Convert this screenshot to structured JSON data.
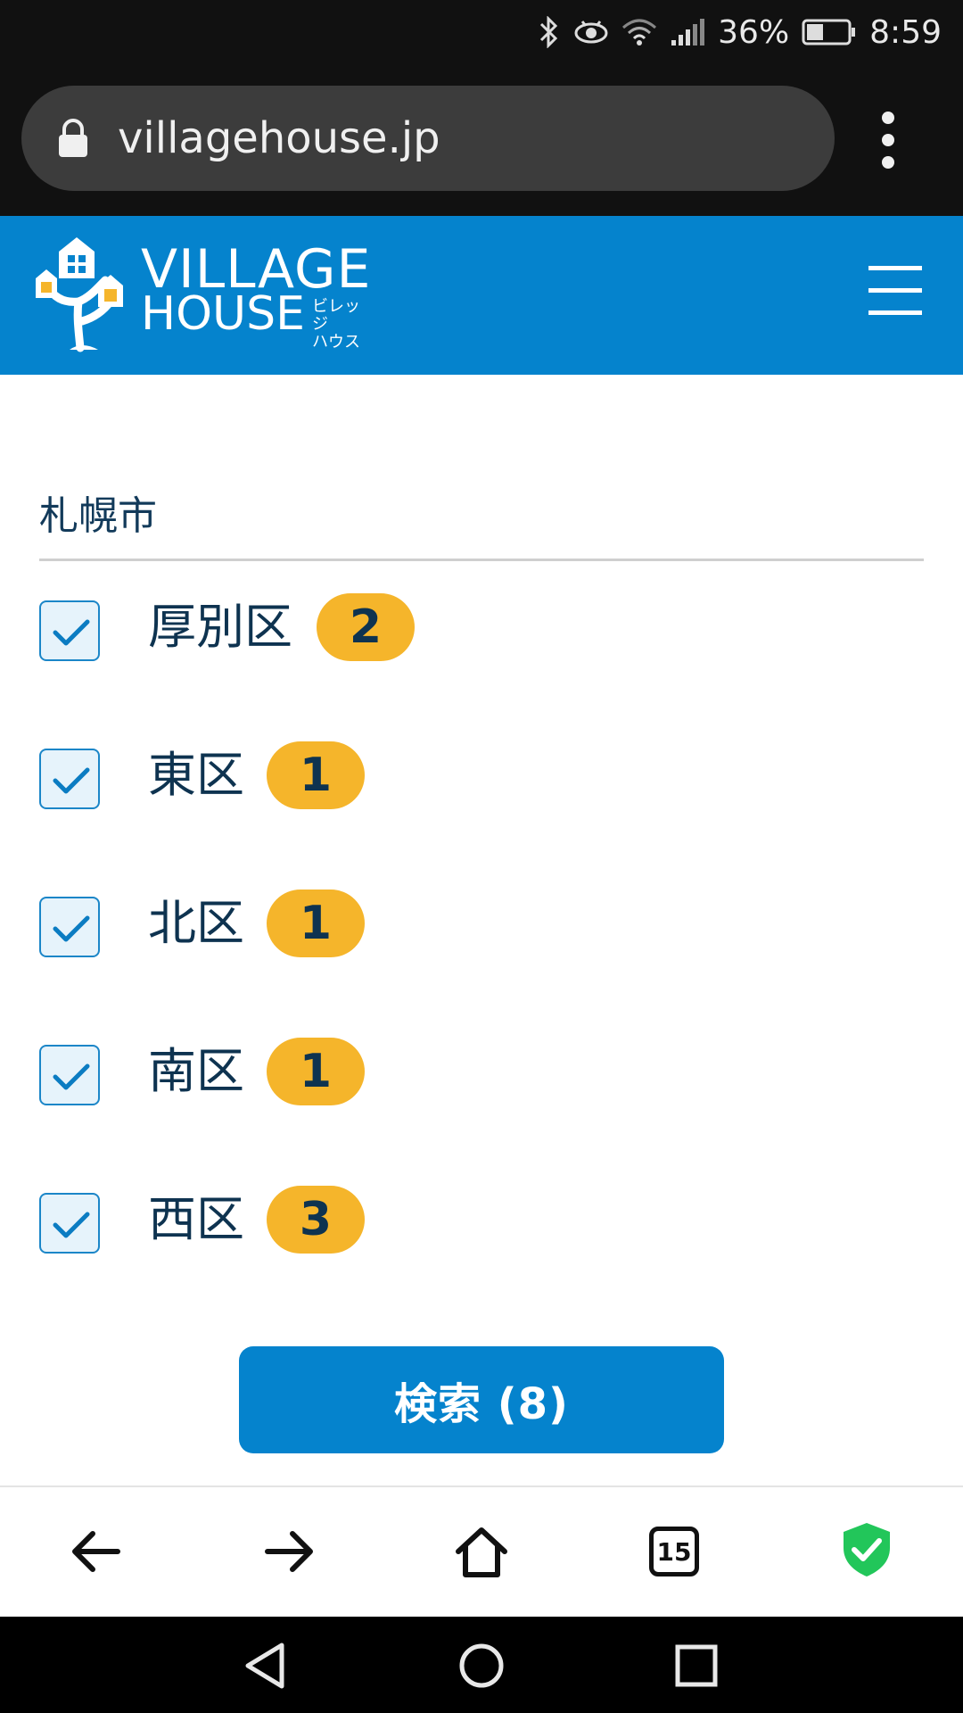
{
  "status_bar": {
    "battery_percent": "36%",
    "time": "8:59",
    "icons": [
      "bluetooth-icon",
      "eye-icon",
      "wifi-icon",
      "signal-icon",
      "battery-icon"
    ]
  },
  "browser": {
    "url": "villagehouse.jp",
    "lock_icon": "lock-icon",
    "menu_icon": "more-vert-icon"
  },
  "header": {
    "logo_line1": "VILLAGE",
    "logo_line2": "HOUSE",
    "logo_kana_line1": "ビレッジ",
    "logo_kana_line2": "ハウス",
    "brand_color": "#0583cd",
    "menu_icon": "hamburger-icon"
  },
  "filter": {
    "city": "札幌市",
    "wards": [
      {
        "label": "厚別区",
        "count": "2",
        "checked": true
      },
      {
        "label": "東区",
        "count": "1",
        "checked": true
      },
      {
        "label": "北区",
        "count": "1",
        "checked": true
      },
      {
        "label": "南区",
        "count": "1",
        "checked": true
      },
      {
        "label": "西区",
        "count": "3",
        "checked": true
      }
    ],
    "badge_color": "#f5b52b"
  },
  "search_button": {
    "label": "検索 (8)"
  },
  "browser_toolbar": {
    "back_icon": "arrow-left-icon",
    "forward_icon": "arrow-right-icon",
    "home_icon": "home-icon",
    "tabs_count": "15",
    "shield_icon": "shield-check-icon"
  },
  "nav_bar": {
    "icons": [
      "back-triangle-icon",
      "home-circle-icon",
      "recents-square-icon"
    ]
  }
}
